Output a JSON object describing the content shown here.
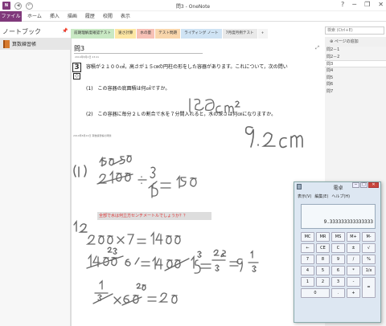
{
  "app": {
    "title": "問3 - OneNote",
    "logo": "N"
  },
  "qat": {
    "back_icon": "back-icon",
    "undo_glyph": "↶"
  },
  "ribbon": {
    "file": "ファイル",
    "menus": [
      "ホーム",
      "挿入",
      "描画",
      "履歴",
      "校閲",
      "表示"
    ]
  },
  "window_controls": {
    "help": "?",
    "min": "─",
    "restore": "❐",
    "close": "✕"
  },
  "notebook": {
    "header": "ノートブック",
    "pin": "📌",
    "item": "算数練習帳"
  },
  "sections": [
    {
      "label": "前期理解度確認テスト",
      "color": "#c9e9c4"
    },
    {
      "label": "速さ計算",
      "color": "#fde6a3"
    },
    {
      "label": "水の量",
      "color": "#f7c1b6"
    },
    {
      "label": "テスト問題",
      "color": "#f9d6ac"
    },
    {
      "label": "ライティング ノート",
      "color": "#cfe3f4"
    },
    {
      "label": "7月度月例テスト",
      "color": "#e9e9e9"
    }
  ],
  "add_tab": "+",
  "search": {
    "placeholder": "検索 (Ctrl+E)"
  },
  "add_page": "ページの追加",
  "pages": [
    {
      "label": "問2－1",
      "selected": false
    },
    {
      "label": "問2－2",
      "selected": false
    },
    {
      "label": "問3",
      "selected": true
    },
    {
      "label": "問4",
      "selected": false
    },
    {
      "label": "問5",
      "selected": false
    },
    {
      "label": "問6",
      "selected": false
    },
    {
      "label": "問7",
      "selected": false
    }
  ],
  "page": {
    "title": "問3",
    "date": "2014年8月4日    23:41",
    "question_number": "3",
    "problem": "容積が２１００㎤，高さが１５㎝の円柱の形をした容器があります。これについて，次の問い",
    "sub1": "(1)　この容器の底面積は何㎠ですか。",
    "sub2": "(2)　この容器に毎分２Ｌの割合で水を７分間入れると，水の深さは何㎝になりますか。",
    "faint_note": "2014年8月22日  算数練習帳の問題",
    "highlight": "全部で水は何立方センチメートルでしょうか？？"
  },
  "calculator": {
    "title": "電卓",
    "menus": [
      "表示(V)",
      "編集(E)",
      "ヘルプ(H)"
    ],
    "display": "9.333333333333333",
    "keys": [
      "MC",
      "MR",
      "MS",
      "M+",
      "M-",
      "←",
      "CE",
      "C",
      "±",
      "√",
      "7",
      "8",
      "9",
      "/",
      "%",
      "4",
      "5",
      "6",
      "*",
      "1/x",
      "1",
      "2",
      "3",
      "-",
      "=",
      "0",
      ".",
      "+"
    ]
  }
}
